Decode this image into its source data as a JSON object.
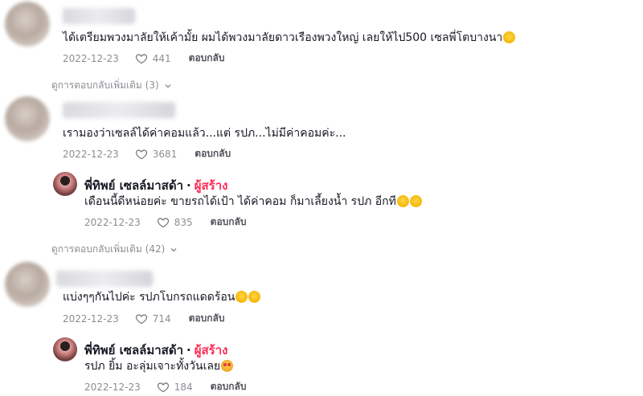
{
  "comments": [
    {
      "text": "ได้เตรียมพวงมาลัยให้เค้ามั้ย ผมได้พวงมาลัยดาวเรืองพวงใหญ่ เลยให้ไป500 เซลพี่โตบางนา",
      "date": "2022-12-23",
      "likes": "441",
      "reply": "ตอบกลับ",
      "emoji": "grinning-face"
    },
    {
      "text": "เรามองว่าเซลล์ได้ค่าคอมแล้ว...แต่ รปภ...ไม่มีค่าคอมค่ะ...",
      "date": "2022-12-23",
      "likes": "3681",
      "reply": "ตอบกลับ"
    },
    {
      "text": "แบ่งๆๆกันไปค่ะ รปภโบกรถแดดร้อน",
      "date": "2022-12-23",
      "likes": "714",
      "reply": "ตอบกลับ",
      "emoji": "grinning-face"
    }
  ],
  "replies": [
    {
      "author": "พี่ทิพย์ เซลล์มาสด้า",
      "separator": "·",
      "badge": "ผู้สร้าง",
      "text": "เดือนนี้ดีหน่อยค่ะ ขายรถได้เป้า ได้ค่าคอม ก็มาเลี้ยงน้ำ รปภ อีกที",
      "date": "2022-12-23",
      "likes": "835",
      "reply": "ตอบกลับ",
      "emoji": "tears-of-joy"
    },
    {
      "author": "พี่ทิพย์ เซลล์มาสด้า",
      "separator": "·",
      "badge": "ผู้สร้าง",
      "text": "รปภ ยิ้ม อะลุ่มเจาะทั้งวันเลย",
      "date": "2022-12-23",
      "likes": "184",
      "reply": "ตอบกลับ",
      "emoji": "smiling-face-with-hearts"
    }
  ],
  "more_replies": [
    {
      "label": "ดูการตอบกลับเพิ่มเติม (3)"
    },
    {
      "label": "ดูการตอบกลับเพิ่มเติม (42)"
    }
  ],
  "colors": {
    "creator_badge": "#fe2c55",
    "muted": "#8a8b91"
  }
}
